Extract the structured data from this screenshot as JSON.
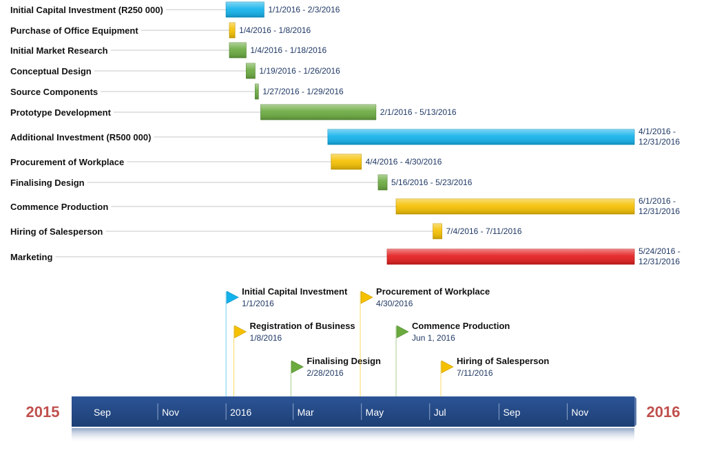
{
  "chart_data": {
    "type": "gantt",
    "tasks": [
      {
        "name": "Initial Capital Investment (R250 000)",
        "start": "2016-01-01",
        "end": "2016-02-03",
        "dates_text": [
          "1/1/2016 - 2/3/2016"
        ],
        "color": "#12b2ec"
      },
      {
        "name": "Purchase of Office Equipment",
        "start": "2016-01-04",
        "end": "2016-01-08",
        "dates_text": [
          "1/4/2016 - 1/8/2016"
        ],
        "color": "#f5c000"
      },
      {
        "name": "Initial Market Research",
        "start": "2016-01-04",
        "end": "2016-01-18",
        "dates_text": [
          "1/4/2016 - 1/18/2016"
        ],
        "color": "#6aaa3f"
      },
      {
        "name": "Conceptual Design",
        "start": "2016-01-19",
        "end": "2016-01-26",
        "dates_text": [
          "1/19/2016 - 1/26/2016"
        ],
        "color": "#6aaa3f"
      },
      {
        "name": "Source Components",
        "start": "2016-01-27",
        "end": "2016-01-29",
        "dates_text": [
          "1/27/2016 - 1/29/2016"
        ],
        "color": "#6aaa3f"
      },
      {
        "name": "Prototype Development",
        "start": "2016-02-01",
        "end": "2016-05-13",
        "dates_text": [
          "2/1/2016 - 5/13/2016"
        ],
        "color": "#6aaa3f"
      },
      {
        "name": "Additional Investment (R500 000)",
        "start": "2016-04-01",
        "end": "2016-12-31",
        "dates_text": [
          "4/1/2016 -",
          "12/31/2016"
        ],
        "color": "#12b2ec"
      },
      {
        "name": "Procurement of Workplace",
        "start": "2016-04-04",
        "end": "2016-04-30",
        "dates_text": [
          "4/4/2016 - 4/30/2016"
        ],
        "color": "#f5c000"
      },
      {
        "name": "Finalising Design",
        "start": "2016-05-16",
        "end": "2016-05-23",
        "dates_text": [
          "5/16/2016 - 5/23/2016"
        ],
        "color": "#6aaa3f"
      },
      {
        "name": "Commence Production",
        "start": "2016-06-01",
        "end": "2016-12-31",
        "dates_text": [
          "6/1/2016 -",
          "12/31/2016"
        ],
        "color": "#f5c000"
      },
      {
        "name": "Hiring of Salesperson",
        "start": "2016-07-04",
        "end": "2016-07-11",
        "dates_text": [
          "7/4/2016 - 7/11/2016"
        ],
        "color": "#f5c000"
      },
      {
        "name": "Marketing",
        "start": "2016-05-24",
        "end": "2016-12-31",
        "dates_text": [
          "5/24/2016 -",
          "12/31/2016"
        ],
        "color": "#e41c1c"
      }
    ],
    "milestones": [
      {
        "title": "Initial Capital Investment",
        "date": "2016-01-01",
        "date_text": "1/1/2016",
        "color": "#12b2ec"
      },
      {
        "title": "Registration of Business",
        "date": "2016-01-08",
        "date_text": "1/8/2016",
        "color": "#f5c000"
      },
      {
        "title": "Finalising Design",
        "date": "2016-02-28",
        "date_text": "2/28/2016",
        "color": "#6aaa3f"
      },
      {
        "title": "Procurement of Workplace",
        "date": "2016-04-30",
        "date_text": "4/30/2016",
        "color": "#f5c000"
      },
      {
        "title": "Commence Production",
        "date": "2016-06-01",
        "date_text": "Jun 1, 2016",
        "color": "#6aaa3f"
      },
      {
        "title": "Hiring of Salesperson",
        "date": "2016-07-11",
        "date_text": "7/11/2016",
        "color": "#f5c000"
      }
    ],
    "timescale": {
      "start": "2015-08-16",
      "end": "2016-12-31",
      "ticks": [
        {
          "label": "Sep",
          "date": "2015-09-01"
        },
        {
          "label": "Nov",
          "date": "2015-11-01"
        },
        {
          "label": "2016",
          "date": "2016-01-01"
        },
        {
          "label": "Mar",
          "date": "2016-03-01"
        },
        {
          "label": "May",
          "date": "2016-05-01"
        },
        {
          "label": "Jul",
          "date": "2016-07-01"
        },
        {
          "label": "Sep",
          "date": "2016-09-01"
        },
        {
          "label": "Nov",
          "date": "2016-11-01"
        }
      ],
      "start_label": "2015",
      "end_label": "2016",
      "bar_color": "#244a86",
      "year_color": "#c0504d"
    }
  }
}
